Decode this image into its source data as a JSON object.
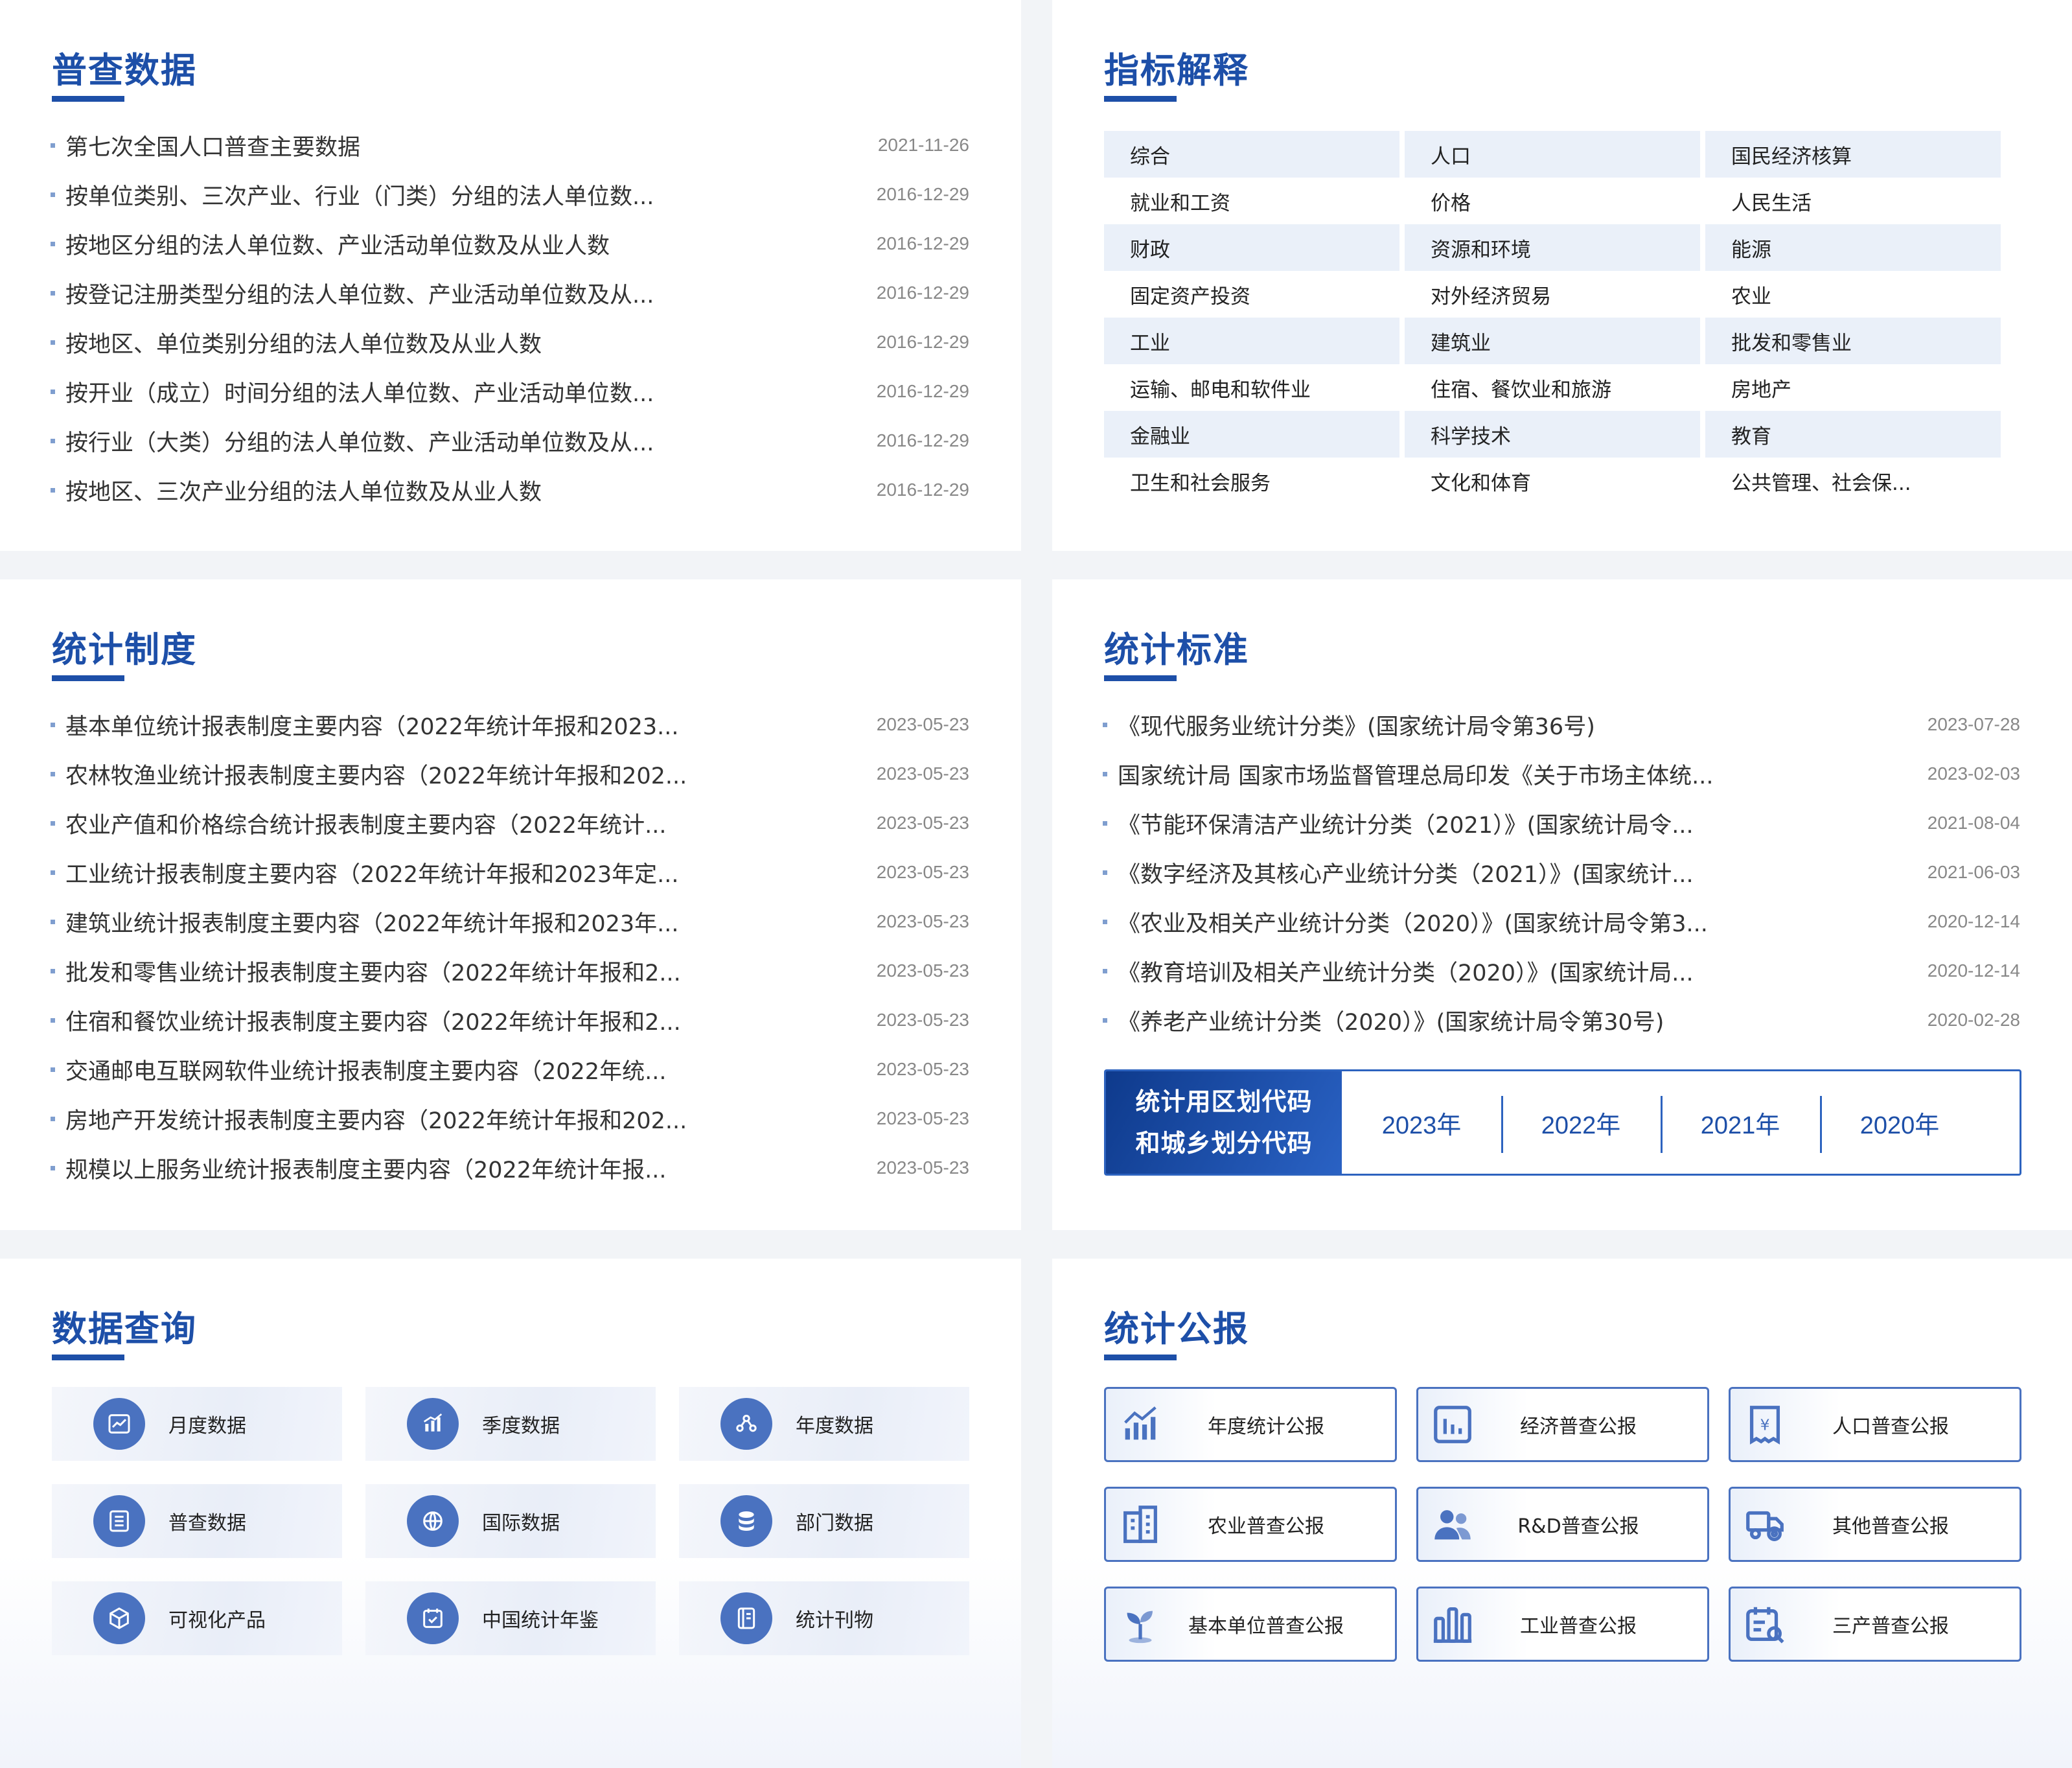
{
  "census": {
    "title": "普查数据",
    "items": [
      {
        "text": "第七次全国人口普查主要数据",
        "date": "2021-11-26"
      },
      {
        "text": "按单位类别、三次产业、行业（门类）分组的法人单位数...",
        "date": "2016-12-29"
      },
      {
        "text": "按地区分组的法人单位数、产业活动单位数及从业人数",
        "date": "2016-12-29"
      },
      {
        "text": "按登记注册类型分组的法人单位数、产业活动单位数及从...",
        "date": "2016-12-29"
      },
      {
        "text": "按地区、单位类别分组的法人单位数及从业人数",
        "date": "2016-12-29"
      },
      {
        "text": "按开业（成立）时间分组的法人单位数、产业活动单位数...",
        "date": "2016-12-29"
      },
      {
        "text": "按行业（大类）分组的法人单位数、产业活动单位数及从...",
        "date": "2016-12-29"
      },
      {
        "text": "按地区、三次产业分组的法人单位数及从业人数",
        "date": "2016-12-29"
      }
    ]
  },
  "indicators": {
    "title": "指标解释",
    "items": [
      "综合",
      "人口",
      "国民经济核算",
      "就业和工资",
      "价格",
      "人民生活",
      "财政",
      "资源和环境",
      "能源",
      "固定资产投资",
      "对外经济贸易",
      "农业",
      "工业",
      "建筑业",
      "批发和零售业",
      "运输、邮电和软件业",
      "住宿、餐饮业和旅游",
      "房地产",
      "金融业",
      "科学技术",
      "教育",
      "卫生和社会服务",
      "文化和体育",
      "公共管理、社会保..."
    ]
  },
  "system": {
    "title": "统计制度",
    "items": [
      {
        "text": "基本单位统计报表制度主要内容（2022年统计年报和2023...",
        "date": "2023-05-23"
      },
      {
        "text": "农林牧渔业统计报表制度主要内容（2022年统计年报和202...",
        "date": "2023-05-23"
      },
      {
        "text": "农业产值和价格综合统计报表制度主要内容（2022年统计...",
        "date": "2023-05-23"
      },
      {
        "text": "工业统计报表制度主要内容（2022年统计年报和2023年定...",
        "date": "2023-05-23"
      },
      {
        "text": "建筑业统计报表制度主要内容（2022年统计年报和2023年...",
        "date": "2023-05-23"
      },
      {
        "text": "批发和零售业统计报表制度主要内容（2022年统计年报和2...",
        "date": "2023-05-23"
      },
      {
        "text": "住宿和餐饮业统计报表制度主要内容（2022年统计年报和2...",
        "date": "2023-05-23"
      },
      {
        "text": "交通邮电互联网软件业统计报表制度主要内容（2022年统...",
        "date": "2023-05-23"
      },
      {
        "text": "房地产开发统计报表制度主要内容（2022年统计年报和202...",
        "date": "2023-05-23"
      },
      {
        "text": "规模以上服务业统计报表制度主要内容（2022年统计年报...",
        "date": "2023-05-23"
      }
    ]
  },
  "standards": {
    "title": "统计标准",
    "items": [
      {
        "text": "《现代服务业统计分类》(国家统计局令第36号)",
        "date": "2023-07-28"
      },
      {
        "text": "国家统计局 国家市场监督管理总局印发《关于市场主体统...",
        "date": "2023-02-03"
      },
      {
        "text": "《节能环保清洁产业统计分类（2021）》(国家统计局令...",
        "date": "2021-08-04"
      },
      {
        "text": "《数字经济及其核心产业统计分类（2021）》(国家统计...",
        "date": "2021-06-03"
      },
      {
        "text": "《农业及相关产业统计分类（2020）》(国家统计局令第3...",
        "date": "2020-12-14"
      },
      {
        "text": "《教育培训及相关产业统计分类（2020）》(国家统计局...",
        "date": "2020-12-14"
      },
      {
        "text": "《养老产业统计分类（2020）》(国家统计局令第30号)",
        "date": "2020-02-28"
      }
    ],
    "code_label_line1": "统计用区划代码",
    "code_label_line2": "和城乡划分代码",
    "code_years": [
      "2023年",
      "2022年",
      "2021年",
      "2020年"
    ]
  },
  "query": {
    "title": "数据查询",
    "items": [
      {
        "label": "月度数据",
        "icon": "line-chart-icon"
      },
      {
        "label": "季度数据",
        "icon": "bar-chart-icon"
      },
      {
        "label": "年度数据",
        "icon": "nodes-icon"
      },
      {
        "label": "普查数据",
        "icon": "list-doc-icon"
      },
      {
        "label": "国际数据",
        "icon": "globe-data-icon"
      },
      {
        "label": "部门数据",
        "icon": "database-icon"
      },
      {
        "label": "可视化产品",
        "icon": "cube-icon"
      },
      {
        "label": "中国统计年鉴",
        "icon": "calendar-check-icon"
      },
      {
        "label": "统计刊物",
        "icon": "journal-icon"
      }
    ]
  },
  "bulletin": {
    "title": "统计公报",
    "items": [
      {
        "label": "年度统计公报",
        "icon": "growth-chart-icon"
      },
      {
        "label": "经济普查公报",
        "icon": "bar-frame-icon"
      },
      {
        "label": "人口普查公报",
        "icon": "receipt-icon"
      },
      {
        "label": "农业普查公报",
        "icon": "building-icon"
      },
      {
        "label": "R&D普查公报",
        "icon": "people-icon"
      },
      {
        "label": "其他普查公报",
        "icon": "truck-gear-icon"
      },
      {
        "label": "基本单位普查公报",
        "icon": "sprout-icon"
      },
      {
        "label": "工业普查公报",
        "icon": "factory-icon"
      },
      {
        "label": "三产普查公报",
        "icon": "calendar-search-icon"
      }
    ]
  },
  "colors": {
    "accent": "#1d4fa8",
    "icon_bg": "#4a72c0",
    "shade": "#eaf0f9"
  }
}
